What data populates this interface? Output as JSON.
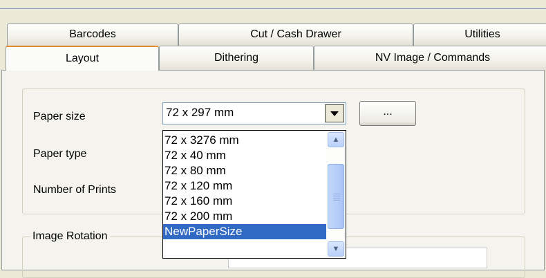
{
  "tabs": {
    "row1": [
      {
        "label": "Barcodes"
      },
      {
        "label": "Cut / Cash Drawer"
      },
      {
        "label": "Utilities"
      }
    ],
    "row2": [
      {
        "label": "Layout",
        "active": true
      },
      {
        "label": "Dithering"
      },
      {
        "label": "NV Image / Commands"
      }
    ]
  },
  "layout": {
    "paper_size_label": "Paper size",
    "paper_type_label": "Paper type",
    "number_of_prints_label": "Number of Prints",
    "paper_size_value": "72 x 297 mm",
    "browse_button_label": "...",
    "image_rotation_label": "Image Rotation"
  },
  "dropdown": {
    "options": [
      "72 x 3276 mm",
      "72 x 40 mm",
      "72 x 80 mm",
      "72 x 120 mm",
      "72 x 160 mm",
      "72 x 200 mm",
      "NewPaperSize"
    ],
    "selected": "NewPaperSize"
  },
  "colors": {
    "selection": "#316ac5",
    "active_tab_accent": "#e68b2c",
    "window_bg": "#ece9d8"
  },
  "icons": {
    "combo_arrow": "chevron-down-icon",
    "scroll_up": "chevron-up-icon",
    "scroll_down": "chevron-down-icon"
  }
}
